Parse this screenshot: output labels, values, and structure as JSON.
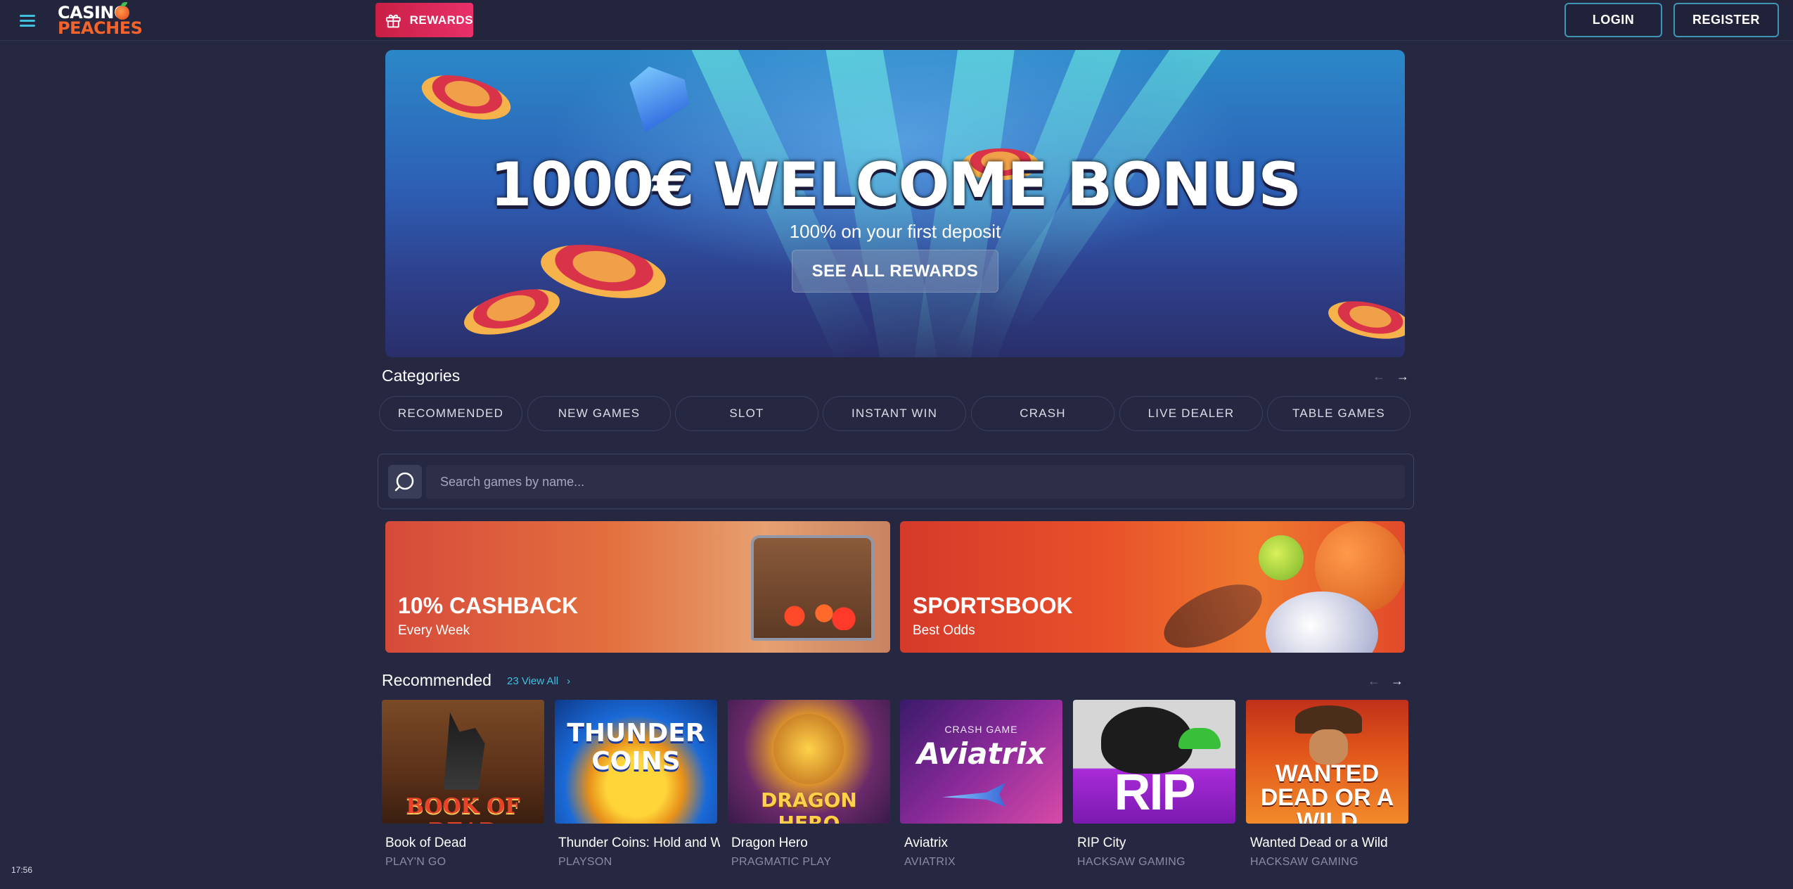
{
  "header": {
    "logo_line1": "CASINO",
    "logo_line2": "PEACHES",
    "rewards_label": "REWARDS",
    "login_label": "LOGIN",
    "register_label": "REGISTER"
  },
  "hero": {
    "title": "1000€ WELCOME BONUS",
    "subtitle": "100% on your first deposit",
    "cta_label": "SEE ALL REWARDS"
  },
  "categories": {
    "title": "Categories",
    "items": [
      "RECOMMENDED",
      "NEW GAMES",
      "SLOT",
      "INSTANT WIN",
      "CRASH",
      "LIVE DEALER",
      "TABLE GAMES"
    ]
  },
  "search": {
    "placeholder": "Search games by name..."
  },
  "promos": [
    {
      "title": "10% CASHBACK",
      "subtitle": "Every Week"
    },
    {
      "title": "SPORTSBOOK",
      "subtitle": "Best Odds"
    }
  ],
  "recommended": {
    "title": "Recommended",
    "view_all": "23 View All",
    "games": [
      {
        "name": "Book of Dead",
        "provider": "PLAY'N GO",
        "art": "BOOK OF DEAD"
      },
      {
        "name": "Thunder Coins: Hold and W",
        "provider": "PLAYSON",
        "art": "THUNDER COINS"
      },
      {
        "name": "Dragon Hero",
        "provider": "PRAGMATIC PLAY",
        "art": "DRAGON HERO"
      },
      {
        "name": "Aviatrix",
        "provider": "AVIATRIX",
        "art": "Aviatrix",
        "art_top": "CRASH GAME"
      },
      {
        "name": "RIP City",
        "provider": "HACKSAW GAMING",
        "art": "RIP CITY"
      },
      {
        "name": "Wanted Dead or a Wild",
        "provider": "HACKSAW GAMING",
        "art": "WANTED DEAD OR A WILD"
      }
    ]
  },
  "clock": "17:56",
  "colors": {
    "background": "#262842",
    "accent": "#3fc0e0",
    "rewards": "#e8306a",
    "brand_orange": "#f4632a"
  }
}
